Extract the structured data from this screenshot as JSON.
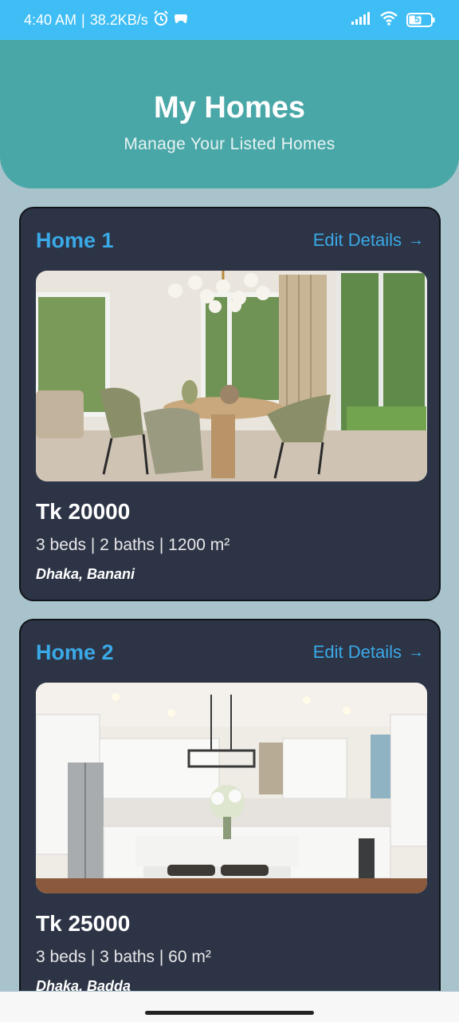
{
  "status_bar": {
    "time": "4:40 AM",
    "speed": "38.2KB/s",
    "battery": "57",
    "icons": [
      "alarm-icon",
      "game-icon",
      "signal-icon",
      "wifi-icon",
      "battery-icon"
    ]
  },
  "header": {
    "title": "My Homes",
    "subtitle": "Manage Your Listed Homes"
  },
  "homes": [
    {
      "title": "Home 1",
      "edit_label": "Edit Details",
      "price": "Tk 20000",
      "specs": "3 beds | 2 baths | 1200 m²",
      "location": "Dhaka, Banani",
      "image_alt": "dining room with chairs and chandelier"
    },
    {
      "title": "Home 2",
      "edit_label": "Edit Details",
      "price": "Tk 25000",
      "specs": "3 beds | 3 baths | 60 m²",
      "location": "Dhaka, Badda",
      "image_alt": "white kitchen with island"
    }
  ],
  "colors": {
    "status_bar": "#3fbef5",
    "header": "#4aa7a7",
    "card": "#2d3445",
    "accent": "#3aa9e8",
    "background": "#a9c3cc"
  }
}
